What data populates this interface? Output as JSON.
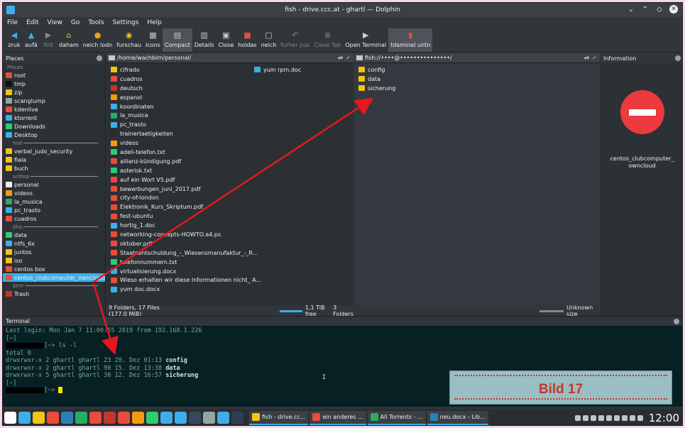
{
  "window": {
    "title": "fish - drive.ccc.at - ghartl — Dolphin"
  },
  "menu": [
    "File",
    "Edit",
    "View",
    "Go",
    "Tools",
    "Settings",
    "Help"
  ],
  "toolbar": [
    {
      "label": "zruk",
      "icon": "back-icon",
      "color": "#3daee9",
      "disabled": false
    },
    {
      "label": "aufä",
      "icon": "up-icon",
      "color": "#3daee9",
      "disabled": false
    },
    {
      "label": "fint",
      "icon": "forward-icon",
      "color": "#7f8c8d",
      "disabled": true
    },
    {
      "label": "daham",
      "icon": "home-icon",
      "color": "#f1c40f",
      "disabled": false
    },
    {
      "label": "neich lodn",
      "icon": "reload-icon",
      "color": "#f39c12",
      "disabled": false
    },
    {
      "label": "furschau",
      "icon": "preview-icon",
      "color": "#f1c40f",
      "disabled": false
    },
    {
      "label": "Icons",
      "icon": "icons-view-icon",
      "color": "#c8ccd0",
      "disabled": false
    },
    {
      "label": "Compact",
      "icon": "compact-view-icon",
      "color": "#c8ccd0",
      "disabled": false,
      "active": true
    },
    {
      "label": "Details",
      "icon": "details-view-icon",
      "color": "#c8ccd0",
      "disabled": false
    },
    {
      "label": "Close",
      "icon": "split-close-icon",
      "color": "#c8ccd0",
      "disabled": false
    },
    {
      "label": "holdas",
      "icon": "stop-icon",
      "color": "#e74c3c",
      "disabled": false
    },
    {
      "label": "neich",
      "icon": "new-tab-icon",
      "color": "#c8ccd0",
      "disabled": false
    },
    {
      "label": "furher pus",
      "icon": "undo-icon",
      "color": "#7f8c8d",
      "disabled": true
    },
    {
      "label": "Close Tab",
      "icon": "close-tab-icon",
      "color": "#7f8c8d",
      "disabled": true
    },
    {
      "label": "Open Terminal",
      "icon": "open-terminal-icon",
      "color": "#c8ccd0",
      "disabled": false
    },
    {
      "label": "tdaminel untn",
      "icon": "terminal-panel-icon",
      "color": "#e74c3c",
      "disabled": false,
      "active": true
    }
  ],
  "places": {
    "title": "Places",
    "section": "Places",
    "items": [
      {
        "type": "item",
        "label": "root",
        "color": "#e74c3c"
      },
      {
        "type": "item",
        "label": "tmp",
        "color": "#111111"
      },
      {
        "type": "item",
        "label": "zip",
        "color": "#f1c40f"
      },
      {
        "type": "item",
        "label": "scanglump",
        "color": "#95a5a6"
      },
      {
        "type": "item",
        "label": "kdenlive",
        "color": "#e74c3c"
      },
      {
        "type": "item",
        "label": "ktorrent",
        "color": "#3daee9"
      },
      {
        "type": "item",
        "label": "Downloads",
        "color": "#2ecc71"
      },
      {
        "type": "item",
        "label": "Desktop",
        "color": "#3daee9"
      },
      {
        "type": "group",
        "label": "hoit"
      },
      {
        "type": "item",
        "label": "verbal_judo_security",
        "color": "#f1c40f"
      },
      {
        "type": "item",
        "label": "fiala",
        "color": "#f1c40f"
      },
      {
        "type": "item",
        "label": "buch",
        "color": "#f1c40f"
      },
      {
        "type": "group",
        "label": "schtop"
      },
      {
        "type": "item",
        "label": "personal",
        "color": "#ecf0f1"
      },
      {
        "type": "item",
        "label": "videos",
        "color": "#f39c12"
      },
      {
        "type": "item",
        "label": "la_musica",
        "color": "#27ae60"
      },
      {
        "type": "item",
        "label": "pc_trasto",
        "color": "#3daee9"
      },
      {
        "type": "item",
        "label": "cuadros",
        "color": "#e74c3c"
      },
      {
        "type": "group",
        "label": "öha"
      },
      {
        "type": "item",
        "label": "data",
        "color": "#2ecc71"
      },
      {
        "type": "item",
        "label": "ntfs_6x",
        "color": "#3daee9"
      },
      {
        "type": "item",
        "label": "juntos",
        "color": "#f1c40f"
      },
      {
        "type": "item",
        "label": "iso",
        "color": "#f1c40f"
      },
      {
        "type": "item",
        "label": "centos box",
        "color": "#e74c3c"
      },
      {
        "type": "item",
        "label": "centos_clubcomputer_owncloud",
        "color": "#e74c3c",
        "selected": true
      },
      {
        "type": "group",
        "label": "brrrr"
      },
      {
        "type": "item",
        "label": "Trash",
        "color": "#c0392b"
      }
    ]
  },
  "left_pane": {
    "path": "/home/wachbirn/personal/",
    "col1": [
      {
        "name": "cifrado",
        "color": "#f1c40f"
      },
      {
        "name": "cuadros",
        "color": "#e74c3c"
      },
      {
        "name": "deutsch",
        "color": "#c0392b"
      },
      {
        "name": "espanol",
        "color": "#f39c12"
      },
      {
        "name": "koordinaten",
        "color": "#3daee9"
      },
      {
        "name": "la_musica",
        "color": "#27ae60"
      },
      {
        "name": "pc_trasto",
        "color": "#3daee9"
      },
      {
        "name": "trainertaetigkeiten",
        "color": "#2c2c2c"
      },
      {
        "name": "videos",
        "color": "#f39c12"
      },
      {
        "name": "adeli-telefon.txt",
        "color": "#2ecc71"
      },
      {
        "name": "allianz-kündigung.pdf",
        "color": "#e74c3c"
      },
      {
        "name": "asterisk.txt",
        "color": "#2ecc71"
      },
      {
        "name": "auf ein Wort V5.pdf",
        "color": "#e74c3c"
      },
      {
        "name": "bewerbungen_juni_2017.pdf",
        "color": "#e74c3c"
      },
      {
        "name": "city-of-london",
        "color": "#e74c3c"
      },
      {
        "name": "Elektronik_Kurs_Skriptum.pdf",
        "color": "#e74c3c"
      },
      {
        "name": "fest-ubuntu",
        "color": "#e74c3c"
      },
      {
        "name": "hortig_1.doc",
        "color": "#3daee9"
      },
      {
        "name": "networking-concepts-HOWTO.a4.ps",
        "color": "#e74c3c"
      },
      {
        "name": "oktober.pdf",
        "color": "#e74c3c"
      },
      {
        "name": "Staatsentschuldung_-_Wiesensmanufaktur_-_R...",
        "color": "#e74c3c"
      },
      {
        "name": "telefonnummern.txt",
        "color": "#2ecc71"
      },
      {
        "name": "virtualisierung.docx",
        "color": "#3daee9"
      },
      {
        "name": "Wieso erhalten wir diese Informationen nicht_ A...",
        "color": "#e74c3c"
      },
      {
        "name": "yum doc.docx",
        "color": "#3daee9"
      }
    ],
    "col2": [
      {
        "name": "yum rpm.doc",
        "color": "#3daee9"
      }
    ],
    "status": "9 Folders, 17 Files (177,0 MiB)",
    "free": "1,1 TiB free"
  },
  "right_pane": {
    "path": "fish://••••@•••••••••••••••/",
    "files": [
      {
        "name": "config",
        "color": "#f1c40f"
      },
      {
        "name": "data",
        "color": "#f1c40f"
      },
      {
        "name": "sicherung",
        "color": "#f1c40f"
      }
    ],
    "status": "3 Folders",
    "free": "Unknown size"
  },
  "info": {
    "title": "Information",
    "name_line1": "centos_clubcomputer_",
    "name_line2": "owncloud",
    "accent": "#ed3a3f"
  },
  "terminal": {
    "title": "Terminal",
    "login": "Last login: Mon Jan  7 11:00:55 2019 from 192.168.1.226",
    "prompt1": "[~]",
    "cmd": "[~> ls -l",
    "total": "total 0",
    "rows": [
      {
        "perm": "drwxrwxr-x 2 ghartl ghartl 23 28. Dez 01:13",
        "name": "config"
      },
      {
        "perm": "drwxrwxr-x 2 ghartl ghartl 90 15. Dez 13:38",
        "name": "data"
      },
      {
        "perm": "drwxrwxr-x 5 ghartl ghartl 38 12. Dez 16:57",
        "name": "sicherung"
      }
    ],
    "prompt2": "[~]",
    "cmd2": "[~> "
  },
  "caption": "Bild 17",
  "taskbar": {
    "launchers": [
      {
        "icon": "app-launcher-icon",
        "color": "#ffffff"
      },
      {
        "icon": "desktop-icon",
        "color": "#3daee9"
      },
      {
        "icon": "home-folder-icon",
        "color": "#f1c40f"
      },
      {
        "icon": "chrome-icon",
        "color": "#e74c3c"
      },
      {
        "icon": "writer-icon",
        "color": "#2980b9"
      },
      {
        "icon": "vivaldi-icon",
        "color": "#27ae60"
      },
      {
        "icon": "pdf-icon",
        "color": "#e74c3c"
      },
      {
        "icon": "flag-icon",
        "color": "#c0392b"
      },
      {
        "icon": "stop-app-icon",
        "color": "#e74c3c"
      },
      {
        "icon": "pen-icon",
        "color": "#f39c12"
      },
      {
        "icon": "android-icon",
        "color": "#2ecc71"
      },
      {
        "icon": "monitor-icon",
        "color": "#3daee9"
      },
      {
        "icon": "minus-circle-icon",
        "color": "#3daee9"
      },
      {
        "icon": "screen-icon",
        "color": "#34495e"
      },
      {
        "icon": "network-icon",
        "color": "#95a5a6"
      },
      {
        "icon": "chat-icon",
        "color": "#3daee9"
      },
      {
        "icon": "terminal-icon",
        "color": "#2c3e50"
      }
    ],
    "tasks": [
      {
        "label": "fish - drive.cc...",
        "color": "#f1c40f"
      },
      {
        "label": "ein anderes ...",
        "color": "#e74c3c"
      },
      {
        "label": "All Torrents - ...",
        "color": "#27ae60"
      },
      {
        "label": "neu.docx - Lib...",
        "color": "#2980b9"
      }
    ],
    "clock": "12:00"
  }
}
